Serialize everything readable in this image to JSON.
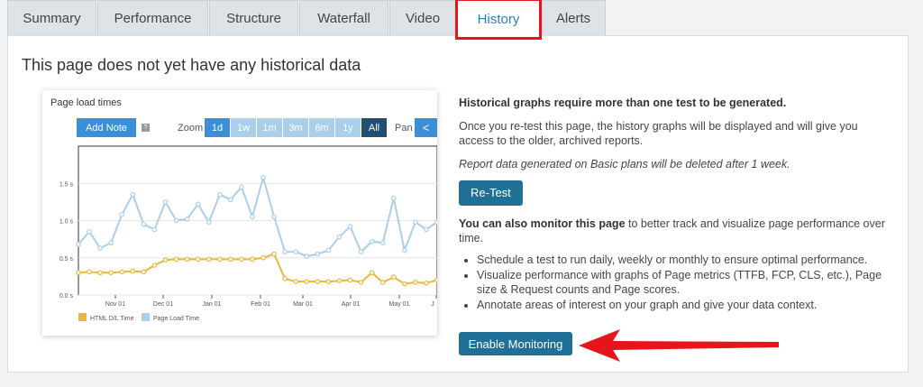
{
  "tabs": [
    "Summary",
    "Performance",
    "Structure",
    "Waterfall",
    "Video",
    "History",
    "Alerts"
  ],
  "active_tab": "History",
  "panel": {
    "title": "This page does not yet have any historical data"
  },
  "chart": {
    "title": "Page load times",
    "add_note": "Add Note",
    "help": "?",
    "zoom_label": "Zoom",
    "zoom_options": [
      "1d",
      "1w",
      "1m",
      "3m",
      "6m",
      "1y",
      "All"
    ],
    "pan_label": "Pan",
    "pan_button": "<",
    "legend": [
      "HTML D/L Time",
      "Page Load Time"
    ]
  },
  "chart_data": {
    "type": "line",
    "title": "Page load times",
    "y_ticks": [
      "0.0 s",
      "0.5 s",
      "1.0 s",
      "1.5 s"
    ],
    "x_ticks": [
      "Nov 01",
      "Dec 01",
      "Jan 01",
      "Feb 01",
      "Mar 01",
      "Apr 01",
      "May 01",
      "J"
    ],
    "ylim": [
      0,
      2
    ],
    "series": [
      {
        "name": "Page Load Time",
        "color": "#a9cfea",
        "values": [
          0.68,
          0.85,
          0.63,
          0.7,
          1.08,
          1.35,
          0.95,
          0.88,
          1.25,
          1.0,
          1.02,
          1.22,
          0.98,
          1.35,
          1.28,
          1.45,
          1.05,
          1.58,
          1.05,
          0.58,
          0.58,
          0.52,
          0.55,
          0.6,
          0.78,
          0.92,
          0.58,
          0.72,
          0.7,
          1.3,
          0.6,
          0.98,
          0.88,
          0.98
        ]
      },
      {
        "name": "HTML D/L Time",
        "color": "#e8b83a",
        "values": [
          0.3,
          0.31,
          0.3,
          0.3,
          0.31,
          0.32,
          0.31,
          0.4,
          0.47,
          0.48,
          0.48,
          0.48,
          0.48,
          0.48,
          0.48,
          0.48,
          0.48,
          0.5,
          0.55,
          0.22,
          0.18,
          0.18,
          0.18,
          0.18,
          0.19,
          0.2,
          0.17,
          0.3,
          0.17,
          0.24,
          0.15,
          0.17,
          0.16,
          0.2
        ]
      }
    ]
  },
  "info": {
    "heading": "Historical graphs require more than one test to be generated.",
    "p1": "Once you re-test this page, the history graphs will be displayed and will give you access to the older, archived reports.",
    "p2": "Report data generated on Basic plans will be deleted after 1 week.",
    "retest": "Re-Test",
    "monitor_bold": "You can also monitor this page",
    "monitor_text": " to better track and visualize page performance over time.",
    "bullets": [
      "Schedule a test to run daily, weekly or monthly to ensure optimal performance.",
      "Visualize performance with graphs of Page metrics (TTFB, FCP, CLS, etc.), Page size & Request counts and Page scores.",
      "Annotate areas of interest on your graph and give your data context."
    ],
    "enable_monitoring": "Enable Monitoring"
  },
  "colors": {
    "accent": "#1f6f96",
    "highlight": "#e8141b",
    "zoom_active": "#214f72"
  }
}
